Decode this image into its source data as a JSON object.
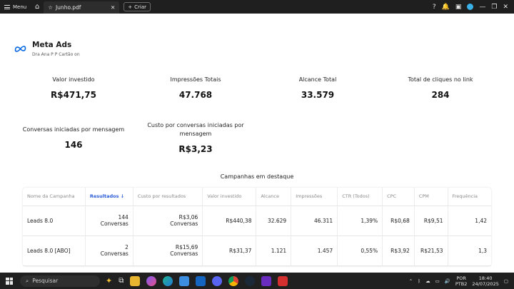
{
  "topbar": {
    "menu_label": "Menu",
    "tab_title": "Junho.pdf",
    "new_label": "Criar"
  },
  "brand": {
    "title": "Meta Ads",
    "subtitle": "Dra Ana P P Cartão on"
  },
  "kpis": [
    {
      "label": "Valor investido",
      "value": "R$471,75"
    },
    {
      "label": "Impressões Totais",
      "value": "47.768"
    },
    {
      "label": "Alcance Total",
      "value": "33.579"
    },
    {
      "label": "Total de cliques no link",
      "value": "284"
    },
    {
      "label": "Conversas iniciadas por mensagem",
      "value": "146"
    },
    {
      "label": "Custo por conversas iniciadas por mensagem",
      "value": "R$3,23"
    }
  ],
  "campaigns": {
    "title": "Campanhas em destaque",
    "headers": [
      "Nome da Campanha",
      "Resultados",
      "Custo por resultados",
      "Valor investido",
      "Alcance",
      "Impressões",
      "CTR (Todos)",
      "CPC",
      "CPM",
      "Frequência"
    ],
    "rows": [
      {
        "name": "Leads 8.0",
        "results": "144",
        "results_unit": "Conversas",
        "cost": "R$3,06",
        "cost_unit": "Conversas",
        "invested": "R$440,38",
        "reach": "32.629",
        "impressions": "46.311",
        "ctr": "1,39%",
        "cpc": "R$0,68",
        "cpm": "R$9,51",
        "frequency": "1,42"
      },
      {
        "name": "Leads 8.0 [ABO]",
        "results": "2",
        "results_unit": "Conversas",
        "cost": "R$15,69",
        "cost_unit": "Conversas",
        "invested": "R$31,37",
        "reach": "1.121",
        "impressions": "1.457",
        "ctr": "0,55%",
        "cpc": "R$3,92",
        "cpm": "R$21,53",
        "frequency": "1,3"
      }
    ]
  },
  "taskbar": {
    "search_placeholder": "Pesquisar",
    "lang_1": "POR",
    "lang_2": "PTB2",
    "time": "18:40",
    "date": "24/07/2025"
  },
  "colors": {
    "accent": "#2a5bd7",
    "meta_blue": "#0668E1",
    "topbar_bg": "#1f1f1f",
    "taskbar_bg": "#202020"
  }
}
